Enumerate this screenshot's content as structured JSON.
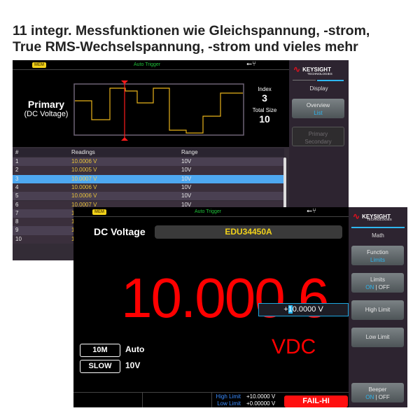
{
  "headline": [
    "11 integr. Messfunktionen wie Gleichspannung, -strom,",
    "True RMS-Wechselspannung, -strom und vieles mehr"
  ],
  "screen1": {
    "mem": "MEM",
    "trigger": "Auto Trigger",
    "usb_icon": "usb-icon",
    "primary": "Primary",
    "primary_sub": "(DC Voltage)",
    "index_label": "Index",
    "index_value": "3",
    "total_label": "Total Size",
    "total_value": "10",
    "brand": "KEYSIGHT",
    "brand_sub": "TECHNOLOGIES",
    "menu_title": "Display",
    "softkeys": [
      {
        "top": "Overview",
        "bottom": "List"
      },
      {
        "top": "Primary",
        "bottom": "Secondary"
      }
    ],
    "table": {
      "headers": [
        "#",
        "Readings",
        "Range"
      ],
      "rows": [
        [
          "1",
          "10.0006  V",
          "10V"
        ],
        [
          "2",
          "10.0005  V",
          "10V"
        ],
        [
          "3",
          "10.0007  V",
          "10V"
        ],
        [
          "4",
          "10.0006  V",
          "10V"
        ],
        [
          "5",
          "10.0006  V",
          "10V"
        ],
        [
          "6",
          "10.0007  V",
          "10V"
        ],
        [
          "7",
          "1",
          ""
        ],
        [
          "8",
          "1",
          ""
        ],
        [
          "9",
          "1",
          ""
        ],
        [
          "10",
          "1",
          ""
        ]
      ],
      "selected_row": 3
    }
  },
  "screen2": {
    "mem": "MEM",
    "trigger": "Auto Trigger",
    "function": "DC Voltage",
    "model": "EDU34450A",
    "reading": "10.000 6",
    "unit": "VDC",
    "edit_value_prefix": "+",
    "edit_cursor": "1",
    "edit_value_rest": "0.0000  V",
    "impedance": "10M",
    "range_mode": "Auto",
    "speed": "SLOW",
    "range": "10V",
    "high_limit_label": "High Limit",
    "high_limit_value": "+10.0000  V",
    "low_limit_label": "Low Limit",
    "low_limit_value": "+0.00000  V",
    "fail": "FAIL-HI",
    "brand": "KEYSIGHT",
    "brand_sub": "TECHNOLOGIES",
    "menu_title": "Math",
    "softkeys": {
      "function": {
        "top": "Function",
        "bottom": "Limits"
      },
      "limits": {
        "top": "Limits",
        "on": "ON",
        "off": "OFF"
      },
      "high": "High Limit",
      "low": "Low Limit",
      "beeper": {
        "top": "Beeper",
        "on": "ON",
        "off": "OFF"
      }
    }
  },
  "colors": {
    "accent": "#2fb7f0",
    "reading": "#ff0000",
    "trace": "#e8b21a",
    "trigger": "#1fc23a",
    "fail": "#ff1010"
  }
}
